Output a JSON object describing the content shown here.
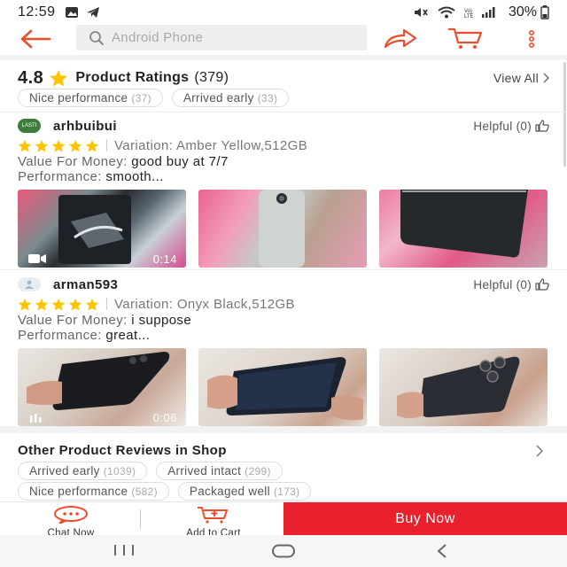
{
  "status_bar": {
    "time": "12:59",
    "network_label": "Vo) LTE",
    "battery": "30%"
  },
  "top_nav": {
    "search_placeholder": "Android Phone"
  },
  "ratings": {
    "score": "4.8",
    "title": "Product Ratings",
    "count": "(379)",
    "view_all": "View All",
    "tags": [
      {
        "label": "Nice performance",
        "count": "(37)"
      },
      {
        "label": "Arrived early",
        "count": "(33)"
      }
    ]
  },
  "reviews": [
    {
      "username": "arhbuibui",
      "avatar_text": "LASTI",
      "helpful": "Helpful (0)",
      "stars": 5,
      "variation": "Variation: Amber Yellow,512GB",
      "value_label": "Value For Money:",
      "value_text": "good buy at 7/7",
      "performance_label": "Performance:",
      "performance_text": "smooth...",
      "video_duration": "0:14"
    },
    {
      "username": "arman593",
      "avatar_text": "",
      "helpful": "Helpful (0)",
      "stars": 5,
      "variation": "Variation: Onyx Black,512GB",
      "value_label": "Value For Money:",
      "value_text": "i suppose",
      "performance_label": "Performance:",
      "performance_text": "great...",
      "video_duration": "0:06"
    }
  ],
  "shop_reviews": {
    "title": "Other Product Reviews in Shop",
    "tags_row1": [
      {
        "label": "Arrived early",
        "count": "(1039)"
      },
      {
        "label": "Arrived intact",
        "count": "(299)"
      }
    ],
    "tags_row2": [
      {
        "label": "Nice performance",
        "count": "(582)"
      },
      {
        "label": "Packaged well",
        "count": "(173)"
      }
    ]
  },
  "bottom_bar": {
    "chat_label": "Chat Now",
    "add_to_cart_label": "Add to Cart",
    "buy_now_label": "Buy Now"
  },
  "colors": {
    "accent": "#ee4d2d",
    "star": "#ffc400",
    "buy_button": "#e8212c"
  },
  "icons": [
    "back-arrow-icon",
    "search-icon",
    "share-icon",
    "cart-icon",
    "more-vertical-icon",
    "star-icon",
    "thumbs-up-icon",
    "video-camera-icon",
    "chat-icon",
    "add-cart-icon"
  ]
}
